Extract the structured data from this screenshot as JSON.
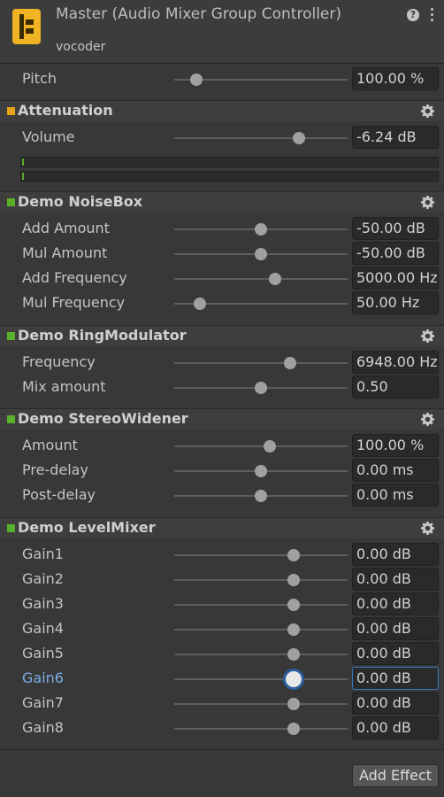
{
  "header": {
    "title": "Master (Audio Mixer Group Controller)",
    "subtitle": "vocoder"
  },
  "pitch": {
    "label": "Pitch",
    "value": "100.00 %",
    "level": 0.13
  },
  "sections": {
    "attenuation": {
      "name": "Attenuation",
      "color": "#e8a317",
      "params": [
        {
          "label": "Volume",
          "value": "-6.24 dB",
          "level": 0.72
        }
      ]
    },
    "noisebox": {
      "name": "Demo NoiseBox",
      "color": "#5ab02a",
      "params": [
        {
          "label": "Add Amount",
          "value": "-50.00 dB",
          "level": 0.5
        },
        {
          "label": "Mul Amount",
          "value": "-50.00 dB",
          "level": 0.5
        },
        {
          "label": "Add Frequency",
          "value": "5000.00 Hz",
          "level": 0.58
        },
        {
          "label": "Mul Frequency",
          "value": "50.00 Hz",
          "level": 0.15
        }
      ]
    },
    "ringmod": {
      "name": "Demo RingModulator",
      "color": "#5ab02a",
      "params": [
        {
          "label": "Frequency",
          "value": "6948.00 Hz",
          "level": 0.67
        },
        {
          "label": "Mix amount",
          "value": "0.50",
          "level": 0.5
        }
      ]
    },
    "stereowidener": {
      "name": "Demo StereoWidener",
      "color": "#5ab02a",
      "params": [
        {
          "label": "Amount",
          "value": "100.00 %",
          "level": 0.55
        },
        {
          "label": "Pre-delay",
          "value": "0.00 ms",
          "level": 0.5
        },
        {
          "label": "Post-delay",
          "value": "0.00 ms",
          "level": 0.5
        }
      ]
    },
    "levelmixer": {
      "name": "Demo LevelMixer",
      "color": "#5ab02a",
      "params": [
        {
          "label": "Gain1",
          "value": "0.00 dB",
          "level": 0.69
        },
        {
          "label": "Gain2",
          "value": "0.00 dB",
          "level": 0.69
        },
        {
          "label": "Gain3",
          "value": "0.00 dB",
          "level": 0.69
        },
        {
          "label": "Gain4",
          "value": "0.00 dB",
          "level": 0.69
        },
        {
          "label": "Gain5",
          "value": "0.00 dB",
          "level": 0.69
        },
        {
          "label": "Gain6",
          "value": "0.00 dB",
          "level": 0.69
        },
        {
          "label": "Gain7",
          "value": "0.00 dB",
          "level": 0.69
        },
        {
          "label": "Gain8",
          "value": "0.00 dB",
          "level": 0.69
        }
      ]
    }
  },
  "footer": {
    "add_effect_label": "Add Effect"
  }
}
